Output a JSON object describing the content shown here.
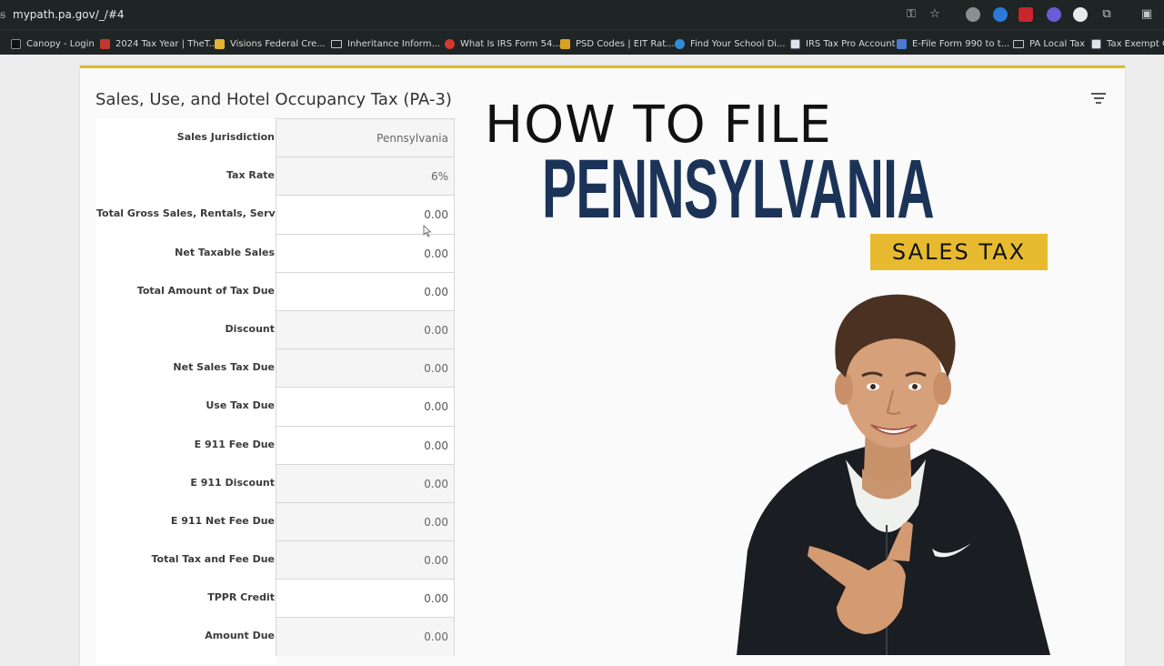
{
  "browser": {
    "url": "mypath.pa.gov/_/#4",
    "bookmarks": [
      {
        "label": "Canopy - Login"
      },
      {
        "label": "2024 Tax Year | TheT..."
      },
      {
        "label": "Visions Federal Cre..."
      },
      {
        "label": "Inheritance Inform..."
      },
      {
        "label": "What Is IRS Form 54..."
      },
      {
        "label": "PSD Codes | EIT Rat..."
      },
      {
        "label": "Find Your School Di..."
      },
      {
        "label": "IRS Tax Pro Account"
      },
      {
        "label": "E-File Form 990 to t..."
      },
      {
        "label": "PA Local Tax"
      },
      {
        "label": "Tax Exempt Or"
      }
    ]
  },
  "card": {
    "title": "Sales, Use, and Hotel Occupancy Tax (PA-3)"
  },
  "form": {
    "rows": [
      {
        "label": "Sales Jurisdiction",
        "value": "Pennsylvania"
      },
      {
        "label": "Tax Rate",
        "value": "6%"
      },
      {
        "label": "Total Gross Sales, Rentals, Services",
        "value": "0.00"
      },
      {
        "label": "Net Taxable Sales",
        "value": "0.00"
      },
      {
        "label": "Total Amount of Tax Due",
        "value": "0.00"
      },
      {
        "label": "Discount",
        "value": "0.00"
      },
      {
        "label": "Net Sales Tax Due",
        "value": "0.00"
      },
      {
        "label": "Use Tax Due",
        "value": "0.00"
      },
      {
        "label": "E 911 Fee Due",
        "value": "0.00"
      },
      {
        "label": "E 911 Discount",
        "value": "0.00"
      },
      {
        "label": "E 911 Net Fee Due",
        "value": "0.00"
      },
      {
        "label": "Total Tax and Fee Due",
        "value": "0.00"
      },
      {
        "label": "TPPR Credit",
        "value": "0.00"
      },
      {
        "label": "Amount Due",
        "value": "0.00"
      }
    ]
  },
  "overlay": {
    "line1": "HOW TO FILE",
    "line2": "PENNSYLVANIA",
    "badge": "SALES TAX",
    "badge_color": "#e8ba2f",
    "title_color": "#1c3358"
  }
}
